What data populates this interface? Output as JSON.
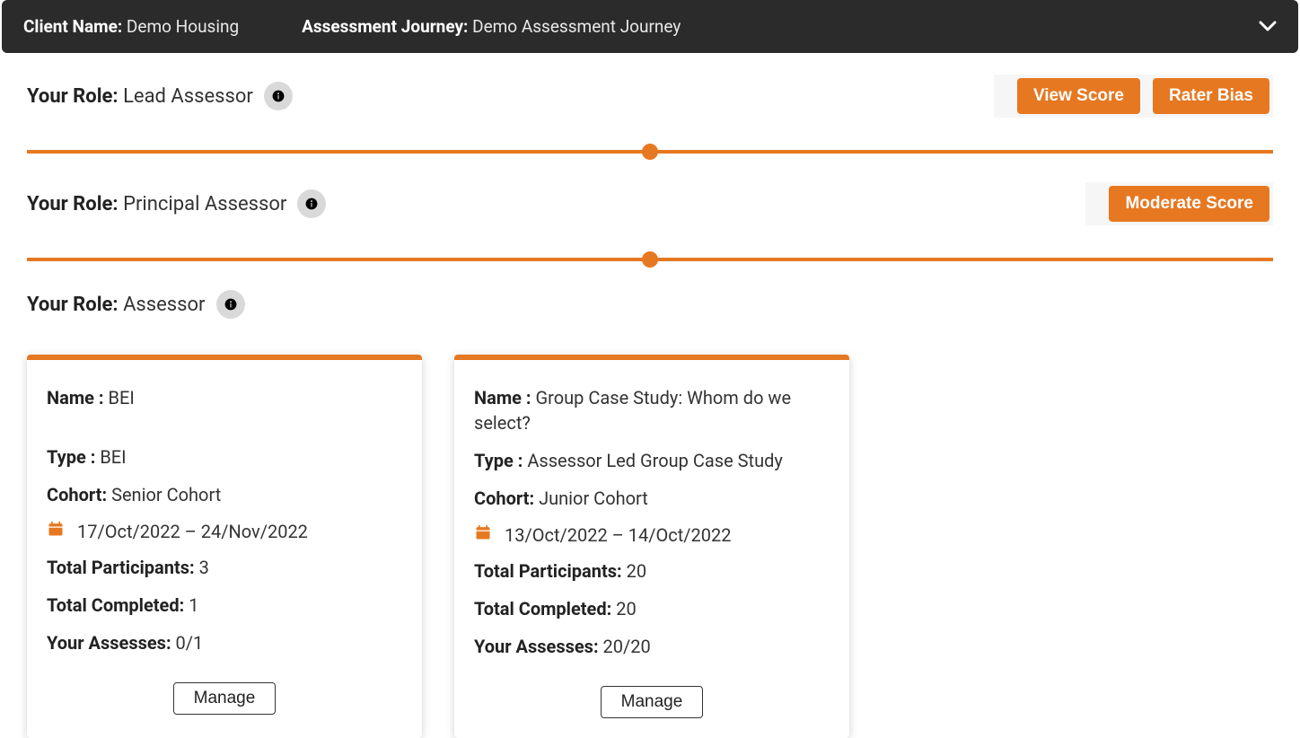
{
  "header": {
    "client_label": "Client Name:",
    "client_value": "Demo Housing",
    "journey_label": "Assessment Journey:",
    "journey_value": "Demo Assessment Journey"
  },
  "roles": {
    "lead": {
      "label": "Your Role:",
      "value": "Lead Assessor",
      "buttons": {
        "view_score": "View Score",
        "rater_bias": "Rater Bias"
      }
    },
    "principal": {
      "label": "Your Role:",
      "value": "Principal Assessor",
      "buttons": {
        "moderate_score": "Moderate Score"
      }
    },
    "assessor": {
      "label": "Your Role:",
      "value": "Assessor"
    }
  },
  "field_labels": {
    "name": "Name :",
    "type": "Type :",
    "cohort": "Cohort:",
    "total_participants": "Total Participants:",
    "total_completed": "Total Completed:",
    "your_assesses": "Your Assesses:",
    "manage": "Manage"
  },
  "cards": [
    {
      "name": "BEI",
      "type": "BEI",
      "cohort": "Senior Cohort",
      "date_range": "17/Oct/2022 – 24/Nov/2022",
      "total_participants": "3",
      "total_completed": "1",
      "your_assesses": "0/1"
    },
    {
      "name": "Group Case Study: Whom do we select?",
      "type": "Assessor Led Group Case Study",
      "cohort": "Junior Cohort",
      "date_range": "13/Oct/2022 – 14/Oct/2022",
      "total_participants": "20",
      "total_completed": "20",
      "your_assesses": "20/20"
    }
  ],
  "colors": {
    "accent": "#e67821",
    "header_bg": "#2b2b2b"
  }
}
